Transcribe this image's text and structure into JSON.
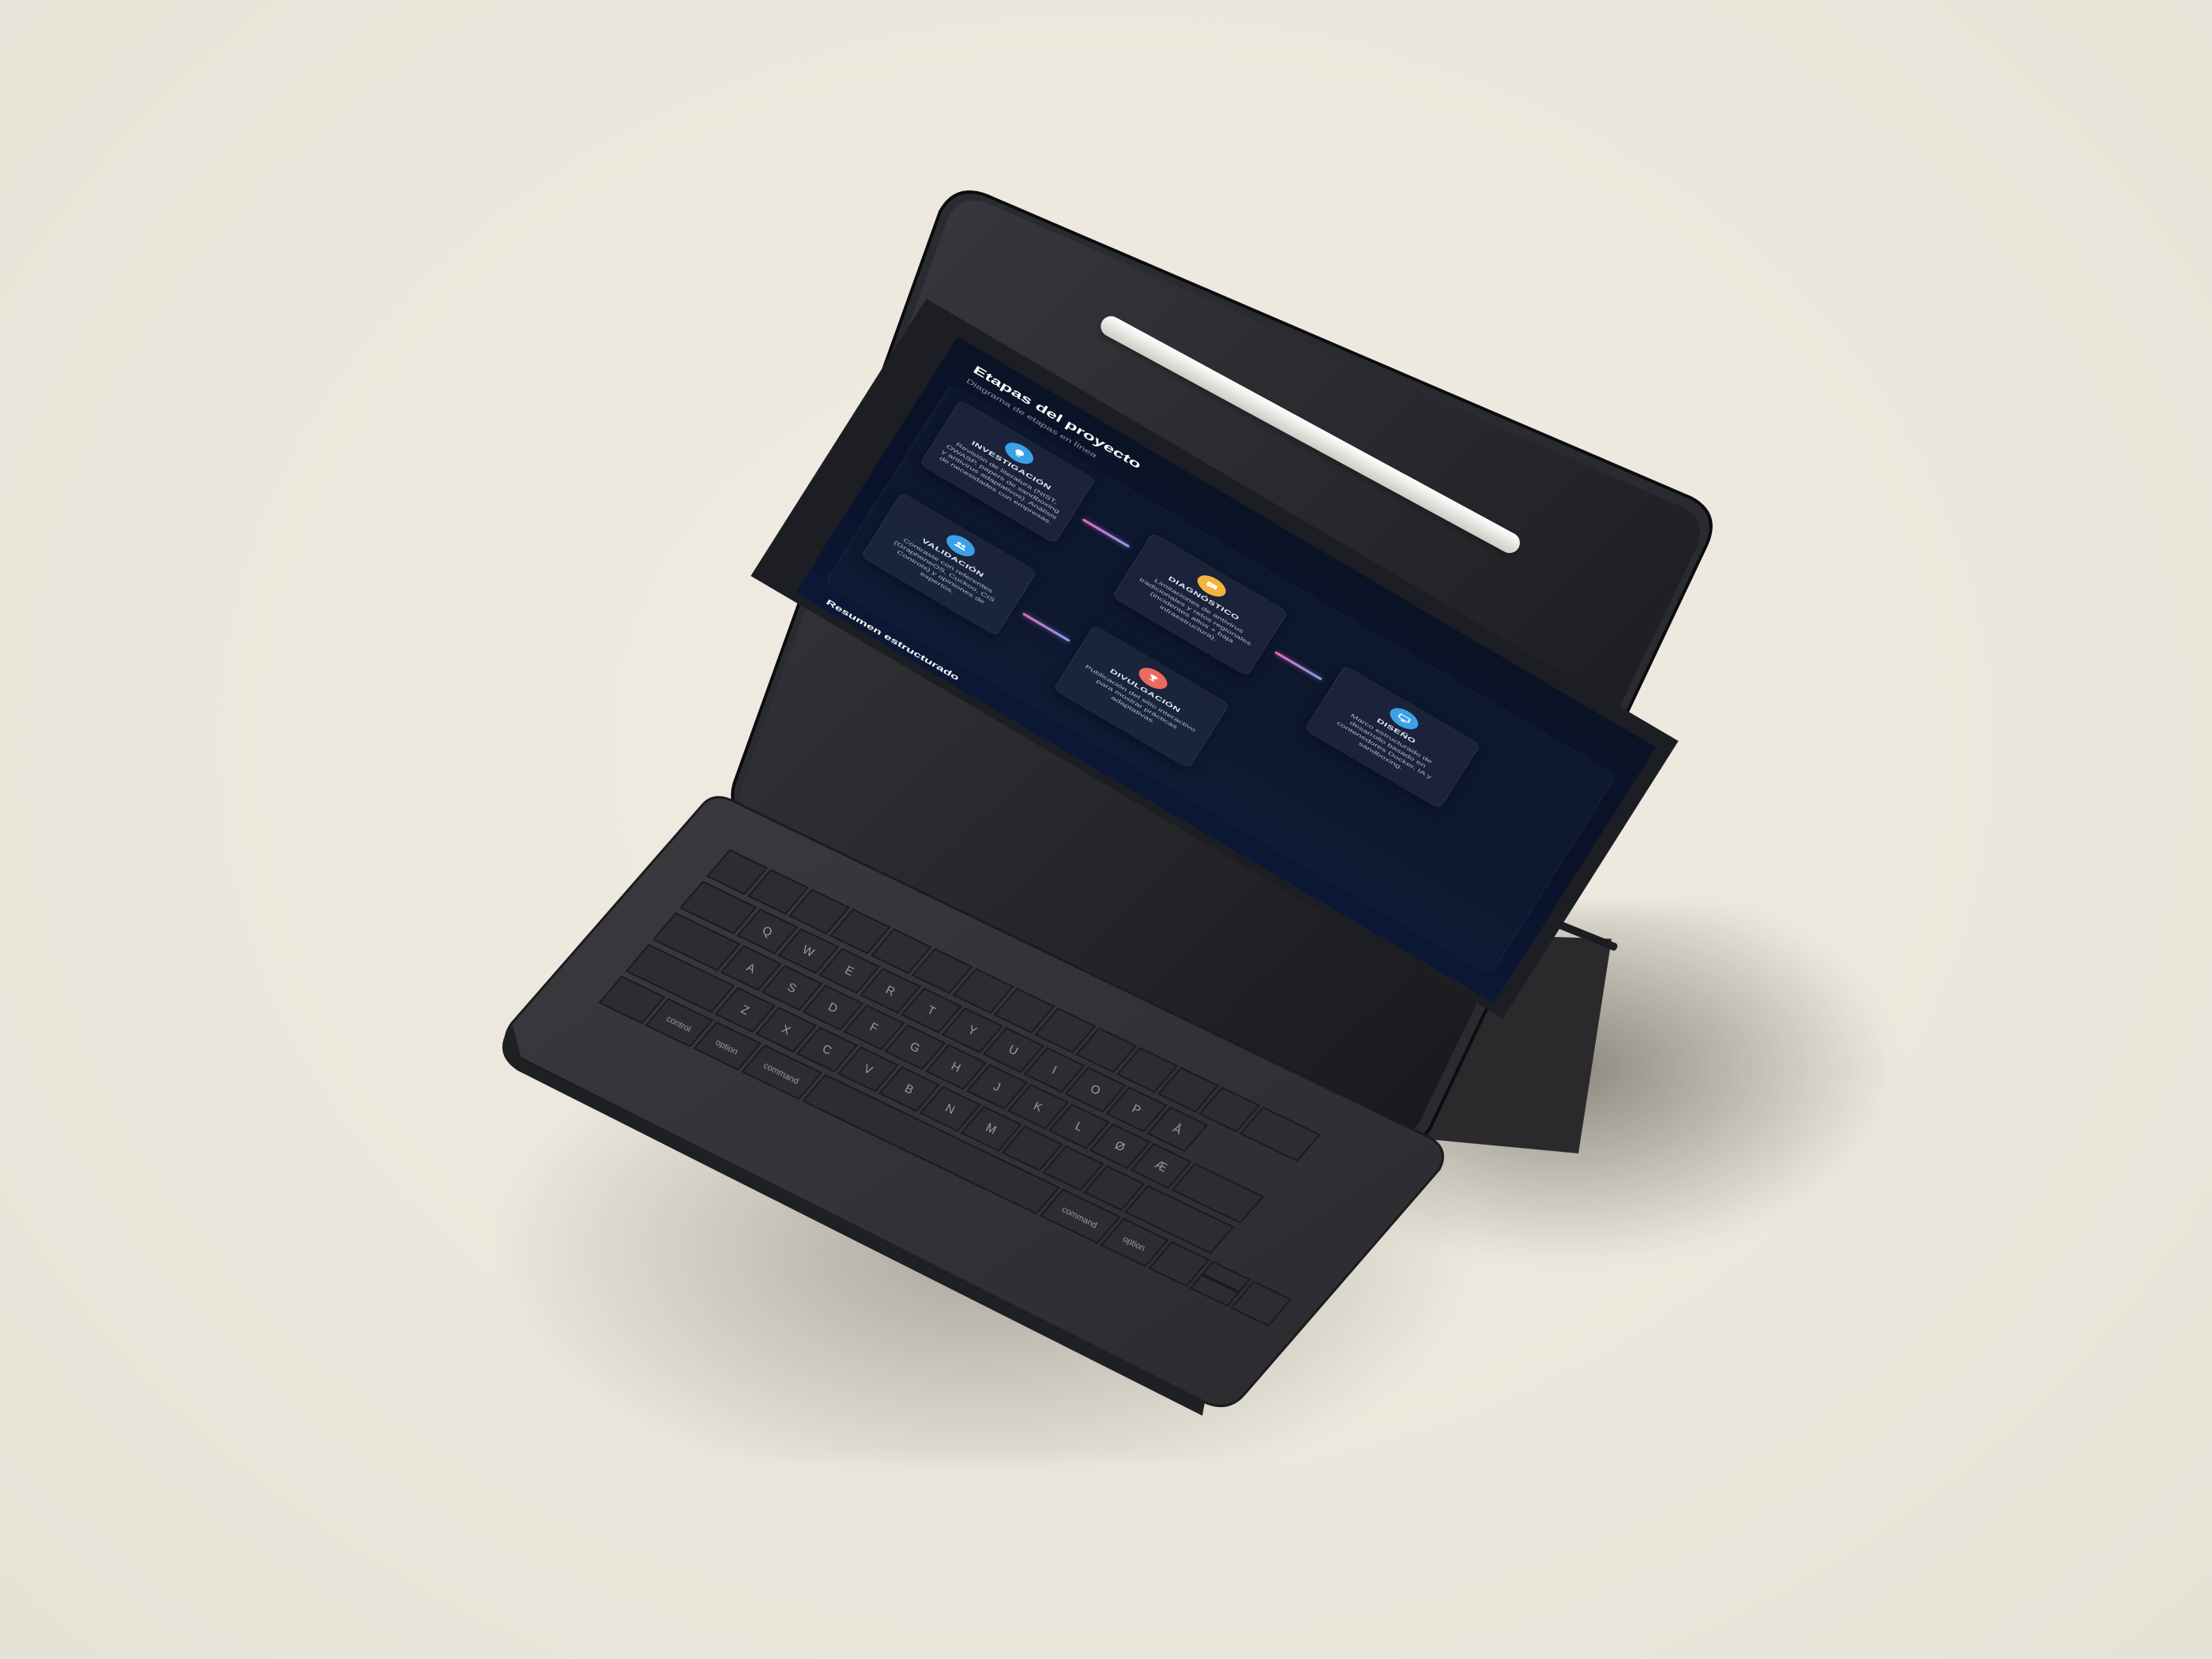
{
  "app": {
    "title": "Etapas del proyecto",
    "subtitle": "Diagrama de etapas en línea",
    "section_title": "Resumen estructurado"
  },
  "stages": [
    {
      "title": "INVESTIGACIÓN",
      "description": "Revisión de literatura (NIST, OWASP, papers de sandboxing y antivirus adaptativos). Análisis de necesidades con empresas.",
      "icon": "lightbulb-icon",
      "color": "#3aa0e8"
    },
    {
      "title": "DIAGNÓSTICO",
      "description": "Limitaciones de antivirus tradicionales y retos regionales (incidentes altos + baja infraestructura).",
      "icon": "chat-icon",
      "color": "#f2b43c"
    },
    {
      "title": "DISEÑO",
      "description": "Marco estructurado de desarrollo basado en contenedores Docker, IA y sandboxing.",
      "icon": "monitor-icon",
      "color": "#3aa0e8"
    },
    {
      "title": "VALIDACIÓN",
      "description": "Contraste con referentes (GrapheneOS, Cuckoo, CIS Controls) y opiniones de expertos.",
      "icon": "users-icon",
      "color": "#3aa0e8"
    },
    {
      "title": "DIVULGACIÓN",
      "description": "Publicación del sitio interactivo para mostrar prácticas adaptativas.",
      "icon": "trophy-icon",
      "color": "#ee6a5f"
    }
  ],
  "keyboard": {
    "row1": [
      "Q",
      "W",
      "E",
      "R",
      "T",
      "Y",
      "U",
      "I",
      "O",
      "P",
      "Å"
    ],
    "row2": [
      "A",
      "S",
      "D",
      "F",
      "G",
      "H",
      "J",
      "K",
      "L",
      "Ø",
      "Æ"
    ],
    "row3": [
      "Z",
      "X",
      "C",
      "V",
      "B",
      "N",
      "M"
    ],
    "modifiers": {
      "control": "control",
      "option_left": "option",
      "command_left": "command",
      "command_right": "command",
      "option_right": "option"
    }
  }
}
